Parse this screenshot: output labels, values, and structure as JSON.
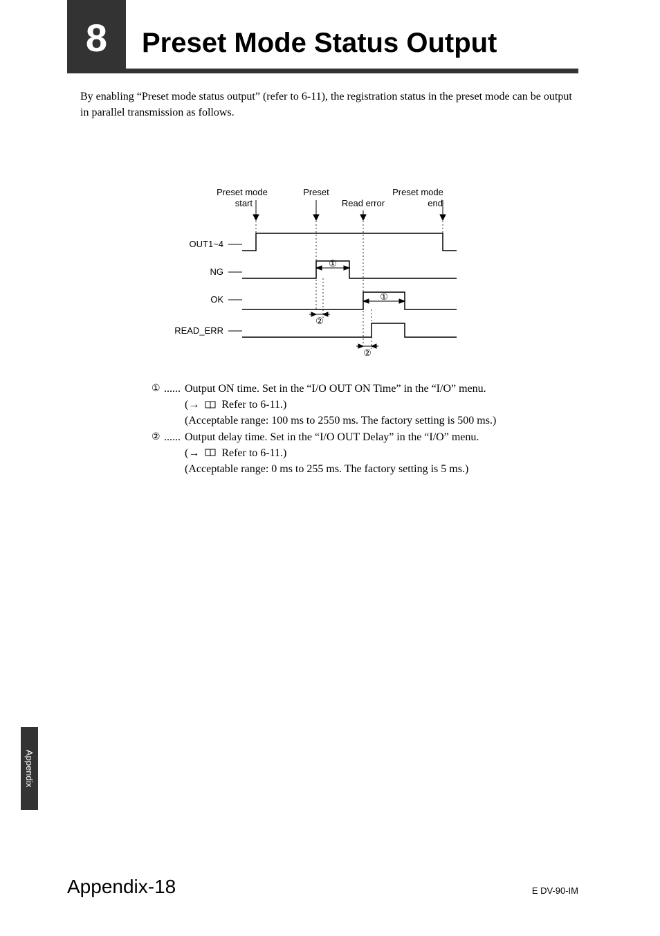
{
  "header": {
    "section_number": "8",
    "title": "Preset Mode Status Output"
  },
  "intro_text": "By enabling “Preset mode status output” (refer to 6-11), the registration status in the preset mode can be output in parallel transmission as follows.",
  "diagram": {
    "top_labels": {
      "preset_mode_start_1": "Preset mode",
      "preset_mode_start_2": "start",
      "preset": "Preset",
      "read_error": "Read error",
      "preset_mode_end_1": "Preset mode",
      "preset_mode_end_2": "end"
    },
    "signals": [
      "OUT1~4",
      "NG",
      "OK",
      "READ_ERR"
    ],
    "markers": {
      "one": "①",
      "two": "②"
    }
  },
  "notes": {
    "dots": "......",
    "item1": {
      "marker": "①",
      "line1": "Output ON time. Set in the “I/O OUT ON Time” in the “I/O” menu.",
      "refer_prefix": "(",
      "arrow": "→",
      "refer_text": "Refer to 6-11.)",
      "range": "(Acceptable range: 100 ms to 2550 ms. The factory setting is 500 ms.)"
    },
    "item2": {
      "marker": "②",
      "line1": "Output delay time. Set in the “I/O OUT Delay” in the “I/O” menu.",
      "refer_prefix": "(",
      "arrow": "→",
      "refer_text": "Refer to 6-11.)",
      "range": "(Acceptable range: 0 ms to 255 ms. The factory setting is 5 ms.)"
    }
  },
  "side_tab": "Appendix",
  "footer": {
    "left": "Appendix-18",
    "right": "E DV-90-IM"
  }
}
